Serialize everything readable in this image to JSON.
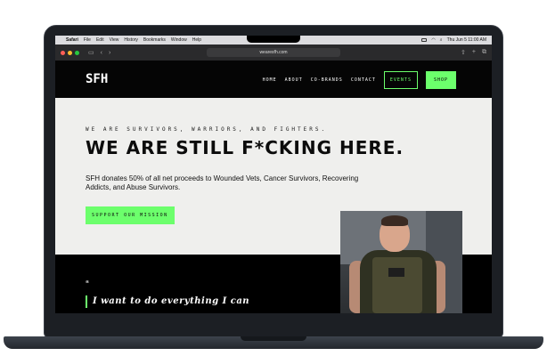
{
  "menubar": {
    "app": "Safari",
    "items": [
      "File",
      "Edit",
      "View",
      "History",
      "Bookmarks",
      "Window",
      "Help"
    ],
    "clock": "Thu Jun 5  11:00 AM"
  },
  "browser": {
    "url": "wearesfh.com"
  },
  "site": {
    "logo": "SFH",
    "nav": [
      "HOME",
      "ABOUT",
      "CO-BRANDS",
      "CONTACT"
    ],
    "events_label": "EVENTS",
    "shop_label": "SHOP"
  },
  "hero": {
    "tagline": "WE ARE SURVIVORS, WARRIORS, AND FIGHTERS.",
    "headline": "WE ARE STILL F*CKING HERE.",
    "subtext": "SFH donates 50% of all net proceeds to Wounded Vets, Cancer Survivors, Recovering Addicts, and Abuse Survivors.",
    "cta": "SUPPORT OUR MISSION"
  },
  "quote": {
    "mark": "“",
    "text": "I want to do everything I can"
  },
  "colors": {
    "accent": "#6cff6c",
    "dark": "#050505",
    "hero_bg": "#efefed"
  }
}
